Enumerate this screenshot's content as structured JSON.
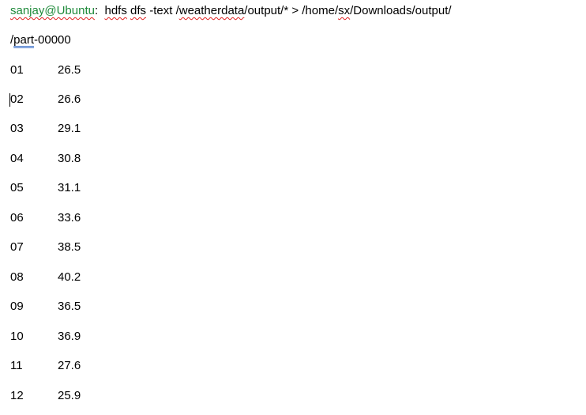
{
  "command": {
    "prompt": "sanjay@Ubuntu",
    "colon": ":",
    "cmd_hdfs": "hdfs",
    "cmd_dfs": "dfs",
    "flag": "-text",
    "src_prefix": "/",
    "src_word": "weatherdata",
    "src_suffix": "/output/* > /home/",
    "dest_user": "sx",
    "dest_suffix": "/Downloads/output/",
    "cont_prefix": "/",
    "cont_word": "part",
    "cont_suffix": "-00000"
  },
  "rows": [
    {
      "month": "01",
      "temp": "26.5"
    },
    {
      "month": "02",
      "temp": "26.6"
    },
    {
      "month": "03",
      "temp": "29.1"
    },
    {
      "month": "04",
      "temp": "30.8"
    },
    {
      "month": "05",
      "temp": "31.1"
    },
    {
      "month": "06",
      "temp": "33.6"
    },
    {
      "month": "07",
      "temp": "38.5"
    },
    {
      "month": "08",
      "temp": "40.2"
    },
    {
      "month": "09",
      "temp": "36.5"
    },
    {
      "month": "10",
      "temp": "36.9"
    },
    {
      "month": "11",
      "temp": "27.6"
    },
    {
      "month": "12",
      "temp": "25.9"
    }
  ]
}
